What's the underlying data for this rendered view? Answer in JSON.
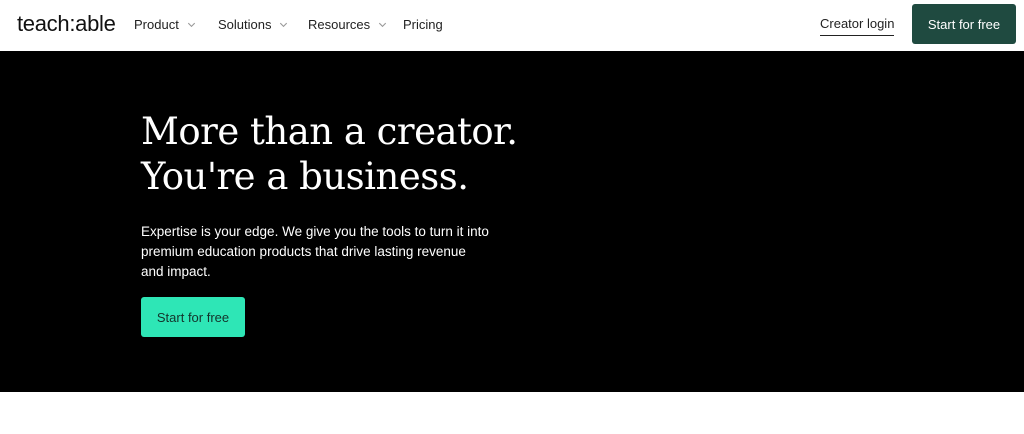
{
  "brand": {
    "logo_text": "teach:able"
  },
  "nav": {
    "items": [
      {
        "label": "Product",
        "has_dropdown": true
      },
      {
        "label": "Solutions",
        "has_dropdown": true
      },
      {
        "label": "Resources",
        "has_dropdown": true
      },
      {
        "label": "Pricing",
        "has_dropdown": false
      }
    ],
    "login_label": "Creator login",
    "cta_label": "Start for free"
  },
  "hero": {
    "title_line1": "More than a creator.",
    "title_line2": "You're a business.",
    "subtitle": "Expertise is your edge. We give you the tools to turn it into premium education products that drive lasting revenue and impact.",
    "cta_label": "Start for free"
  },
  "colors": {
    "brand_dark_green": "#1f4a40",
    "accent_mint": "#2ee6b6",
    "hero_bg": "#000000"
  },
  "icons": {
    "dropdown": "chevron-down-icon"
  }
}
